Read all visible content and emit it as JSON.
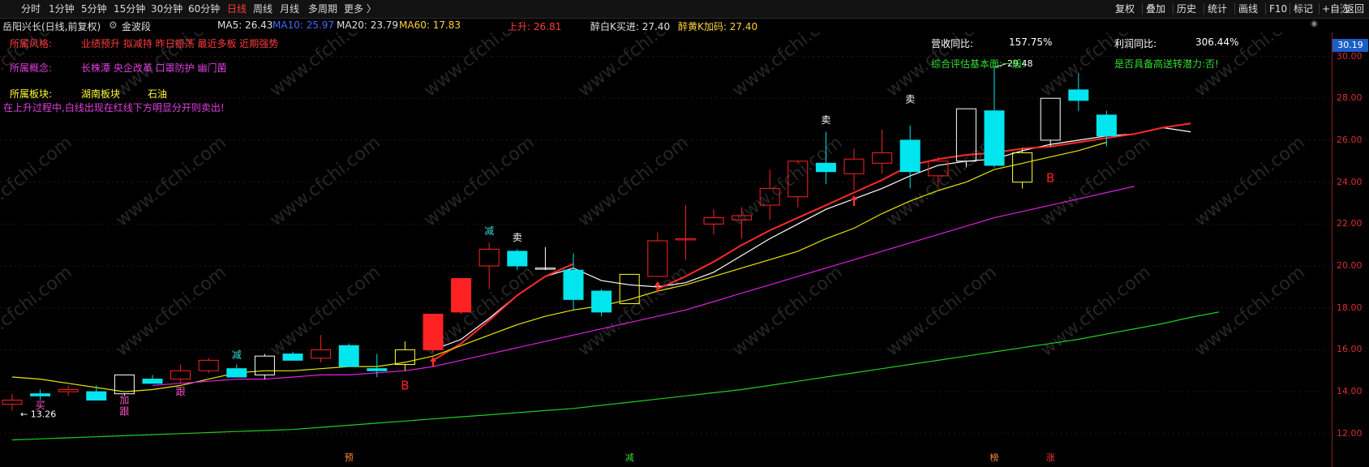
{
  "toolbar": {
    "periods": [
      "分时",
      "1分钟",
      "5分钟",
      "15分钟",
      "30分钟",
      "60分钟",
      "日线",
      "周线",
      "月线",
      "多周期",
      "更多 〉"
    ],
    "active_period": "日线",
    "right_buttons": [
      "复权",
      "叠加",
      "历史",
      "统计",
      "画线",
      "F10",
      "标记",
      "+自选",
      "返回"
    ]
  },
  "info": {
    "stock_name": "岳阳兴长(日线,前复权)",
    "indicator_name": "金波段",
    "ma5": "MA5: 26.43",
    "ma10": "MA10: 25.97",
    "ma20": "MA20: 23.79",
    "ma60": "MA60: 17.83",
    "trend": "上升: 26.81",
    "buy_k": "醉白K买进: 27.40",
    "add_k": "醉黄K加码: 27.40"
  },
  "panel": {
    "style_label": "所属风格:",
    "style_tags": "业绩预升  拟减持  昨日振荡  最近多板  近期强势",
    "concept_label": "所属概念:",
    "concept_tags": "长株潭  央企改革  口罩防护  幽门菌",
    "sector_label": "所属板块:",
    "sector_tags": "湖南板块",
    "sector_tags2": "石油",
    "alert": "在上升过程中,白线出现在红线下方明显分开则卖出!",
    "revenue_label": "营收同比:",
    "revenue_value": "157.75%",
    "profit_label": "利润同比:",
    "profit_value": "306.44%",
    "eval": "综合评估基本面:一般!",
    "reversal": "是否具备高送转潜力:否!"
  },
  "axis": {
    "current_price": "30.19",
    "ticks": [
      "30.00",
      "28.00",
      "26.00",
      "24.00",
      "22.00",
      "20.00",
      "18.00",
      "16.00",
      "14.00",
      "12.00"
    ]
  },
  "colors": {
    "up": "#ff2222",
    "down": "#00e5ee",
    "white_k": "#ffffff",
    "yellow_k": "#ffff33",
    "ma_white": "#ffffff",
    "ma_red": "#ff2a2a",
    "ma_yellow": "#e6e600",
    "ma_magenta": "#e020e0",
    "ma_green": "#22cc22"
  },
  "chart_data": {
    "type": "candlestick",
    "ylim": [
      11.8,
      30.6
    ],
    "candles": [
      {
        "o": 13.4,
        "h": 13.9,
        "l": 13.1,
        "c": 13.6,
        "t": "up"
      },
      {
        "o": 13.8,
        "h": 14.1,
        "l": 13.6,
        "c": 13.9,
        "t": "down"
      },
      {
        "o": 14.0,
        "h": 14.3,
        "l": 13.8,
        "c": 14.1,
        "t": "up"
      },
      {
        "o": 14.0,
        "h": 14.3,
        "l": 13.6,
        "c": 13.6,
        "t": "down"
      },
      {
        "o": 13.9,
        "h": 14.8,
        "l": 13.8,
        "c": 14.8,
        "t": "white"
      },
      {
        "o": 14.6,
        "h": 14.8,
        "l": 14.4,
        "c": 14.4,
        "t": "down"
      },
      {
        "o": 14.6,
        "h": 15.3,
        "l": 14.4,
        "c": 15.0,
        "t": "up"
      },
      {
        "o": 15.0,
        "h": 15.6,
        "l": 14.9,
        "c": 15.5,
        "t": "up"
      },
      {
        "o": 15.1,
        "h": 15.3,
        "l": 14.7,
        "c": 14.7,
        "t": "down"
      },
      {
        "o": 14.8,
        "h": 15.8,
        "l": 14.6,
        "c": 15.7,
        "t": "white"
      },
      {
        "o": 15.8,
        "h": 15.9,
        "l": 15.5,
        "c": 15.5,
        "t": "down"
      },
      {
        "o": 15.6,
        "h": 16.7,
        "l": 15.4,
        "c": 16.0,
        "t": "up"
      },
      {
        "o": 16.2,
        "h": 16.3,
        "l": 15.2,
        "c": 15.2,
        "t": "down"
      },
      {
        "o": 15.1,
        "h": 15.8,
        "l": 14.7,
        "c": 15.0,
        "t": "down"
      },
      {
        "o": 15.3,
        "h": 16.4,
        "l": 15.0,
        "c": 16.0,
        "t": "yellow"
      },
      {
        "o": 16.0,
        "h": 17.7,
        "l": 15.9,
        "c": 17.7,
        "t": "redfill"
      },
      {
        "o": 17.8,
        "h": 19.4,
        "l": 17.7,
        "c": 19.4,
        "t": "redfill"
      },
      {
        "o": 20.0,
        "h": 21.1,
        "l": 18.9,
        "c": 20.8,
        "t": "up"
      },
      {
        "o": 20.7,
        "h": 20.8,
        "l": 19.8,
        "c": 20.0,
        "t": "down"
      },
      {
        "o": 19.9,
        "h": 20.9,
        "l": 19.8,
        "c": 19.9,
        "t": "white"
      },
      {
        "o": 19.8,
        "h": 20.6,
        "l": 17.9,
        "c": 18.4,
        "t": "down"
      },
      {
        "o": 18.8,
        "h": 18.9,
        "l": 17.6,
        "c": 17.8,
        "t": "down"
      },
      {
        "o": 18.2,
        "h": 19.6,
        "l": 18.2,
        "c": 19.6,
        "t": "yellow"
      },
      {
        "o": 19.5,
        "h": 21.6,
        "l": 19.5,
        "c": 21.2,
        "t": "up"
      },
      {
        "o": 21.3,
        "h": 22.9,
        "l": 20.3,
        "c": 21.3,
        "t": "up"
      },
      {
        "o": 22.0,
        "h": 22.7,
        "l": 21.5,
        "c": 22.3,
        "t": "up"
      },
      {
        "o": 22.2,
        "h": 22.8,
        "l": 21.3,
        "c": 22.4,
        "t": "up"
      },
      {
        "o": 22.9,
        "h": 24.6,
        "l": 22.2,
        "c": 23.7,
        "t": "up"
      },
      {
        "o": 23.3,
        "h": 24.9,
        "l": 22.8,
        "c": 25.0,
        "t": "up"
      },
      {
        "o": 24.5,
        "h": 26.4,
        "l": 23.9,
        "c": 24.9,
        "t": "down"
      },
      {
        "o": 24.4,
        "h": 25.6,
        "l": 23.6,
        "c": 25.1,
        "t": "up"
      },
      {
        "o": 24.9,
        "h": 26.5,
        "l": 24.4,
        "c": 25.4,
        "t": "up"
      },
      {
        "o": 26.0,
        "h": 26.7,
        "l": 23.7,
        "c": 24.5,
        "t": "down"
      },
      {
        "o": 24.3,
        "h": 25.2,
        "l": 23.8,
        "c": 25.0,
        "t": "up"
      },
      {
        "o": 25.0,
        "h": 27.5,
        "l": 24.7,
        "c": 27.5,
        "t": "white"
      },
      {
        "o": 27.4,
        "h": 29.5,
        "l": 24.7,
        "c": 24.8,
        "t": "down"
      },
      {
        "o": 24.0,
        "h": 25.6,
        "l": 23.7,
        "c": 25.4,
        "t": "yellow"
      },
      {
        "o": 26.0,
        "h": 28.0,
        "l": 25.7,
        "c": 28.0,
        "t": "white"
      },
      {
        "o": 28.4,
        "h": 29.2,
        "l": 27.4,
        "c": 27.9,
        "t": "down"
      },
      {
        "o": 27.2,
        "h": 27.4,
        "l": 25.7,
        "c": 26.2,
        "t": "down"
      }
    ],
    "ma_lines": [
      {
        "name": "white",
        "color": "#ffffff",
        "start": 15,
        "values": [
          16.0,
          16.5,
          17.5,
          18.6,
          19.5,
          19.9,
          19.3,
          19.1,
          19.0,
          19.2,
          19.7,
          20.5,
          21.3,
          22.0,
          22.7,
          23.2,
          23.7,
          24.3,
          24.8,
          25.0,
          25.1,
          25.5,
          25.8,
          26.0,
          26.2,
          26.3,
          26.6,
          26.4
        ]
      },
      {
        "name": "red",
        "color": "#ff2a2a",
        "start": 15,
        "values": [
          15.5,
          16.3,
          17.4,
          18.6,
          19.5,
          20.1,
          null,
          null,
          18.9,
          19.5,
          20.2,
          21.0,
          21.7,
          22.3,
          22.9,
          23.5,
          24.1,
          24.8,
          25.1,
          25.3,
          25.4,
          25.6,
          25.7,
          25.9,
          26.1,
          26.3,
          26.6,
          26.8
        ]
      },
      {
        "name": "yellow",
        "color": "#e6e600",
        "start": 0,
        "values": [
          14.7,
          14.6,
          14.4,
          14.2,
          14.0,
          14.1,
          14.3,
          14.6,
          14.9,
          15.0,
          15.0,
          15.1,
          15.2,
          15.2,
          15.4,
          15.7,
          16.2,
          16.7,
          17.2,
          17.6,
          17.9,
          18.1,
          18.4,
          18.8,
          19.1,
          19.5,
          19.9,
          20.3,
          20.7,
          21.3,
          21.8,
          22.5,
          23.1,
          23.6,
          24.0,
          24.6,
          24.9,
          25.2,
          25.5,
          25.9
        ]
      },
      {
        "name": "magenta",
        "color": "#e020e0",
        "start": 5,
        "values": [
          14.3,
          14.4,
          14.5,
          14.6,
          14.6,
          14.7,
          14.8,
          14.8,
          14.9,
          15.0,
          15.2,
          15.5,
          15.8,
          16.1,
          16.4,
          16.7,
          17.0,
          17.3,
          17.6,
          17.9,
          18.3,
          18.7,
          19.1,
          19.5,
          19.9,
          20.3,
          20.7,
          21.1,
          21.5,
          21.9,
          22.3,
          22.6,
          22.9,
          23.2,
          23.5,
          23.8
        ]
      },
      {
        "name": "green",
        "color": "#22cc22",
        "start": 0,
        "values": [
          11.7,
          11.75,
          11.8,
          11.85,
          11.9,
          11.95,
          12.0,
          12.05,
          12.1,
          12.15,
          12.2,
          12.3,
          12.4,
          12.5,
          12.6,
          12.7,
          12.8,
          12.9,
          13.0,
          13.1,
          13.2,
          13.35,
          13.5,
          13.65,
          13.8,
          13.95,
          14.1,
          14.3,
          14.5,
          14.7,
          14.9,
          15.1,
          15.3,
          15.5,
          15.7,
          15.9,
          16.1,
          16.3,
          16.5,
          16.75,
          17.0,
          17.25,
          17.55,
          17.8
        ]
      }
    ],
    "annotations": [
      {
        "i": 1,
        "price": 13.2,
        "text": "买",
        "color": "#ff55cc"
      },
      {
        "i": 4,
        "price": 13.45,
        "text": "加",
        "color": "#ff55cc"
      },
      {
        "i": 4,
        "price": 12.9,
        "text": "跟",
        "color": "#ff55cc"
      },
      {
        "i": 6,
        "price": 13.85,
        "text": "跟",
        "color": "#ff55cc"
      },
      {
        "i": 8,
        "price": 15.6,
        "text": "减",
        "color": "#33dddd"
      },
      {
        "i": 14,
        "price": 14.1,
        "text": "B",
        "color": "#ff2222"
      },
      {
        "i": 17,
        "price": 21.5,
        "text": "减",
        "color": "#33dddd"
      },
      {
        "i": 18,
        "price": 21.2,
        "text": "卖",
        "color": "#ffffff"
      },
      {
        "i": 29,
        "price": 26.8,
        "text": "卖",
        "color": "#ffffff"
      },
      {
        "i": 32,
        "price": 27.8,
        "text": "卖",
        "color": "#ffffff"
      },
      {
        "i": 37,
        "price": 24.0,
        "text": "B",
        "color": "#ff2222"
      }
    ],
    "arrows": [
      15,
      23,
      30
    ],
    "low_label": {
      "i": 0,
      "price": 13.26,
      "text": "13.26"
    },
    "high_label": {
      "i": 35,
      "price": 29.48,
      "text": "29.48"
    },
    "bottom_markers": [
      {
        "i": 12,
        "text": "预",
        "color": "#ff8833"
      },
      {
        "i": 22,
        "text": "减",
        "color": "#33dd33"
      },
      {
        "i": 35,
        "text": "榜",
        "color": "#ff8833"
      },
      {
        "i": 37,
        "text": "涨",
        "color": "#ff3333"
      }
    ]
  }
}
